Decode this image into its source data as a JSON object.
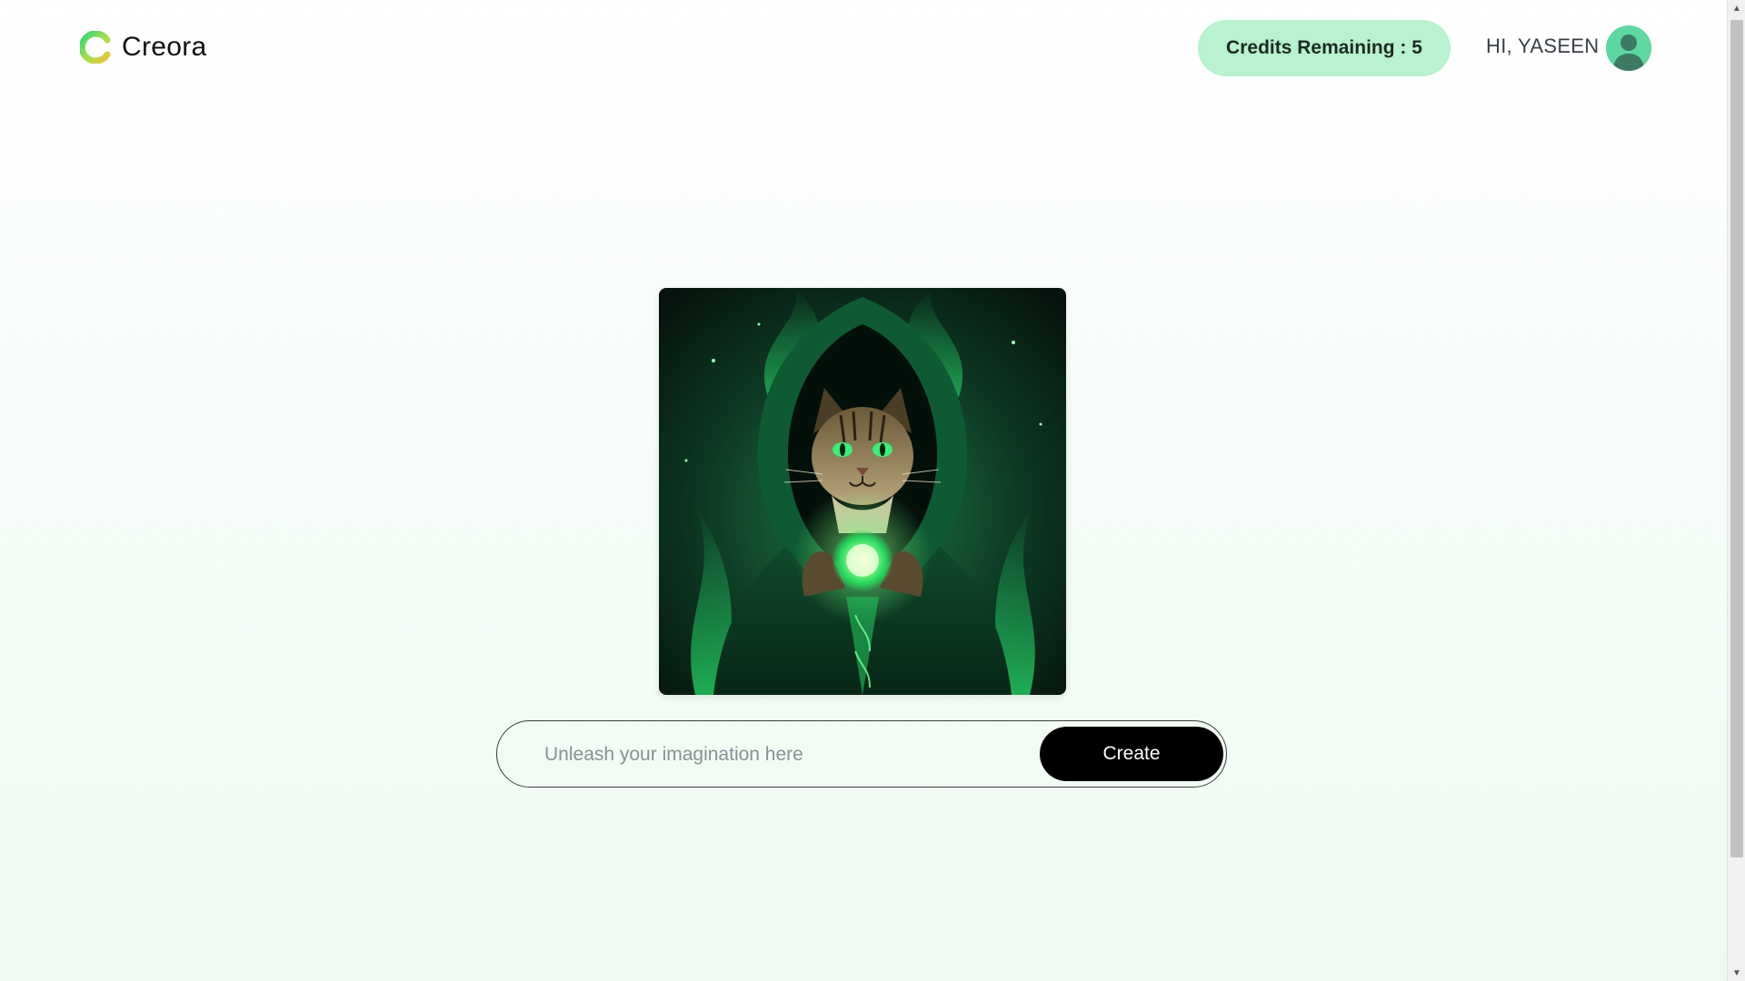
{
  "header": {
    "brand_name": "Creora",
    "logo_icon": "creora-logo-icon",
    "credits_label": "Credits Remaining : 5",
    "greeting": "HI, YASEEN",
    "avatar_icon": "user-avatar-icon"
  },
  "hero": {
    "image_icon": "hooded-cat-wizard-image"
  },
  "prompt": {
    "placeholder": "Unleash your imagination here",
    "value": "",
    "create_label": "Create"
  },
  "colors": {
    "accent": "#b8f2cf",
    "avatar_bg": "#5dd8a0",
    "button_bg": "#000000",
    "glow_green": "#38f07a"
  }
}
